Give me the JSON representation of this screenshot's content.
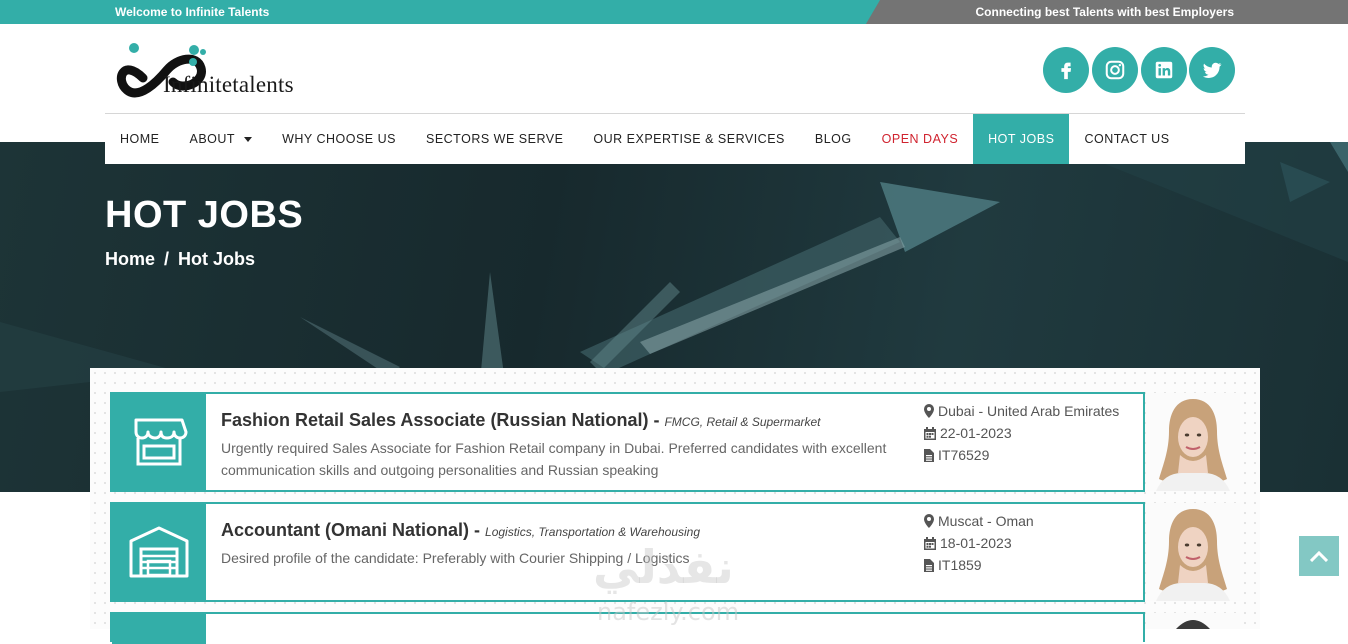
{
  "topbar": {
    "welcome": "Welcome to Infinite Talents",
    "tagline": "Connecting best Talents with best Employers"
  },
  "brand": {
    "name": "Infinitetalents"
  },
  "social": [
    "facebook-icon",
    "instagram-icon",
    "linkedin-icon",
    "twitter-icon"
  ],
  "nav": [
    {
      "label": "HOME"
    },
    {
      "label": "ABOUT"
    },
    {
      "label": "WHY CHOOSE US"
    },
    {
      "label": "SECTORS WE SERVE"
    },
    {
      "label": "OUR EXPERTISE & SERVICES"
    },
    {
      "label": "BLOG"
    },
    {
      "label": "OPEN DAYS"
    },
    {
      "label": "HOT JOBS"
    },
    {
      "label": "CONTACT US"
    }
  ],
  "hero": {
    "title": "HOT JOBS",
    "breadcrumb": [
      "Home",
      "/",
      "Hot Jobs"
    ]
  },
  "jobs": [
    {
      "title": "Fashion Retail Sales Associate (Russian National)",
      "dash": " - ",
      "category": "FMCG, Retail & Supermarket",
      "description": "Urgently required Sales Associate for Fashion Retail company in Dubai. Preferred candidates with excellent communication skills and outgoing personalities and Russian speaking",
      "location": "Dubai - United Arab Emirates",
      "date": "22-01-2023",
      "ref": "IT76529",
      "icon": "store-icon"
    },
    {
      "title": "Accountant (Omani National)",
      "dash": " - ",
      "category": "Logistics, Transportation & Warehousing",
      "description": "Desired profile of the candidate: Preferably with Courier Shipping / Logistics",
      "location": "Muscat - Oman",
      "date": "18-01-2023",
      "ref": "IT1859",
      "icon": "warehouse-icon"
    }
  ],
  "watermark": {
    "arabic": "نفذلي",
    "latin": "nafezly.com"
  },
  "colors": {
    "accent": "#33aea8",
    "red": "#d0232f",
    "topbar_gray": "#747474"
  }
}
